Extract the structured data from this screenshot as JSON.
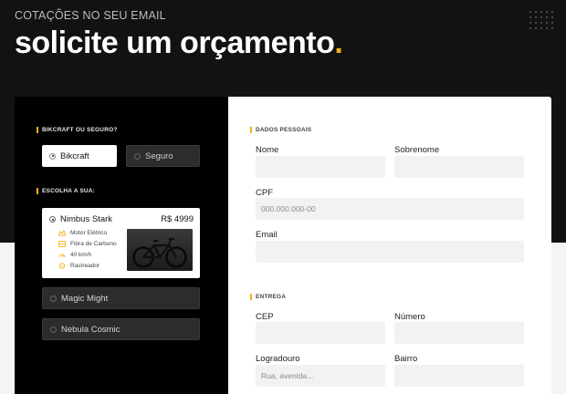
{
  "header": {
    "subtitle": "COTAÇÕES NO SEU EMAIL",
    "title": "solicite um orçamento",
    "title_dot": "."
  },
  "colors": {
    "accent": "#f5b01a",
    "dark_bg": "#121212",
    "panel_bg": "#000000"
  },
  "left": {
    "type_section": "BIKCRAFT OU SEGURO?",
    "options": [
      {
        "label": "Bikcraft",
        "selected": true
      },
      {
        "label": "Seguro",
        "selected": false
      }
    ],
    "bike_section": "ESCOLHA A SUA:",
    "selected_bike": {
      "name": "Nimbus Stark",
      "price": "R$ 4999",
      "features": [
        {
          "icon": "electric-icon",
          "label": "Motor Elétrico"
        },
        {
          "icon": "carbon-icon",
          "label": "Fibra de Carbono"
        },
        {
          "icon": "speed-icon",
          "label": "40 km/h"
        },
        {
          "icon": "tracker-icon",
          "label": "Rastreador"
        }
      ]
    },
    "other_bikes": [
      {
        "name": "Magic Might"
      },
      {
        "name": "Nebula Cosmic"
      }
    ]
  },
  "form": {
    "personal_section": "DADOS PESSOAIS",
    "nome_label": "Nome",
    "sobrenome_label": "Sobrenome",
    "cpf_label": "CPF",
    "cpf_placeholder": "000.000.000-00",
    "email_label": "Email",
    "delivery_section": "ENTREGA",
    "cep_label": "CEP",
    "numero_label": "Número",
    "logradouro_label": "Logradouro",
    "logradouro_placeholder": "Rua, avenida...",
    "bairro_label": "Bairro"
  }
}
